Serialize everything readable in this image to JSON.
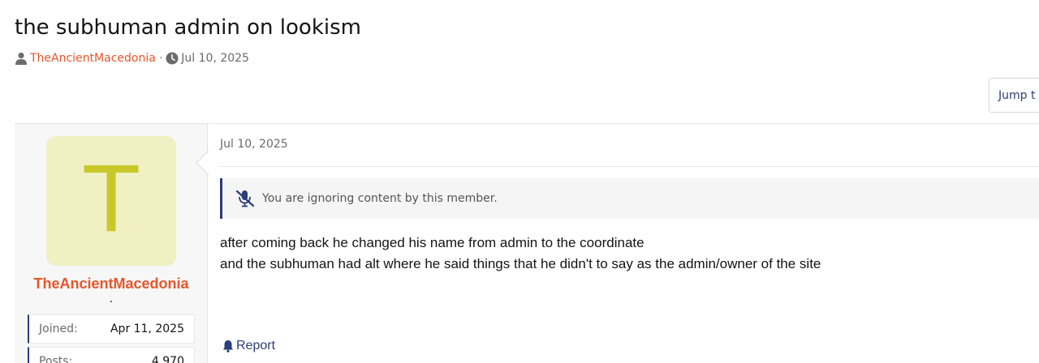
{
  "thread": {
    "title": "the subhuman admin on lookism",
    "author": "TheAncientMacedonia",
    "separator": "·",
    "date": "Jul 10, 2025",
    "author_icon": "user-icon",
    "date_icon": "clock-icon"
  },
  "navigation": {
    "jump_label": "Jump t"
  },
  "user": {
    "avatar_letter": "T",
    "avatar_bg": "#f0f0c2",
    "avatar_fg": "#c8c82a",
    "name": "TheAncientMacedonia",
    "name_color": "#e8552a",
    "title": ".",
    "stats": [
      {
        "label": "Joined:",
        "value": "Apr 11, 2025"
      },
      {
        "label": "Posts:",
        "value": "4,970"
      }
    ]
  },
  "post": {
    "date": "Jul 10, 2025",
    "ignored_notice": "You are ignoring content by this member.",
    "ignored_icon": "muted-microphone-icon",
    "body_lines": [
      "after coming back he changed his name from admin to the coordinate",
      "and the subhuman had alt where he said things that he didn't to say as the admin/owner of the site"
    ],
    "report_label": "Report",
    "report_icon": "bell-icon"
  },
  "colors": {
    "accent": "#e8552a",
    "link": "#2b3d7a"
  }
}
